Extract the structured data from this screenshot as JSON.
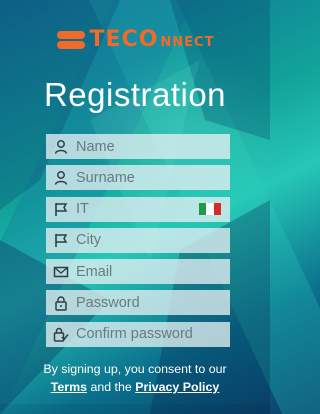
{
  "brand": {
    "logo_big": "TECO",
    "logo_small": "NNECT",
    "accent": "#f06a2a"
  },
  "page": {
    "title": "Registration"
  },
  "form": {
    "name": {
      "placeholder": "Name",
      "icon": "person-icon"
    },
    "surname": {
      "placeholder": "Surname",
      "icon": "person-icon"
    },
    "country": {
      "value": "IT",
      "icon": "flag-icon",
      "flag_colors": [
        "#1f9a45",
        "#ffffff",
        "#d52b2b"
      ]
    },
    "city": {
      "placeholder": "City",
      "icon": "flag-icon"
    },
    "email": {
      "placeholder": "Email",
      "icon": "envelope-icon"
    },
    "password": {
      "placeholder": "Password",
      "icon": "lock-icon"
    },
    "confirm_password": {
      "placeholder": "Confirm password",
      "icon": "lock-check-icon"
    }
  },
  "consent": {
    "line1": "By signing up, you consent to our",
    "terms": "Terms",
    "and": "and the",
    "privacy": "Privacy Policy"
  }
}
